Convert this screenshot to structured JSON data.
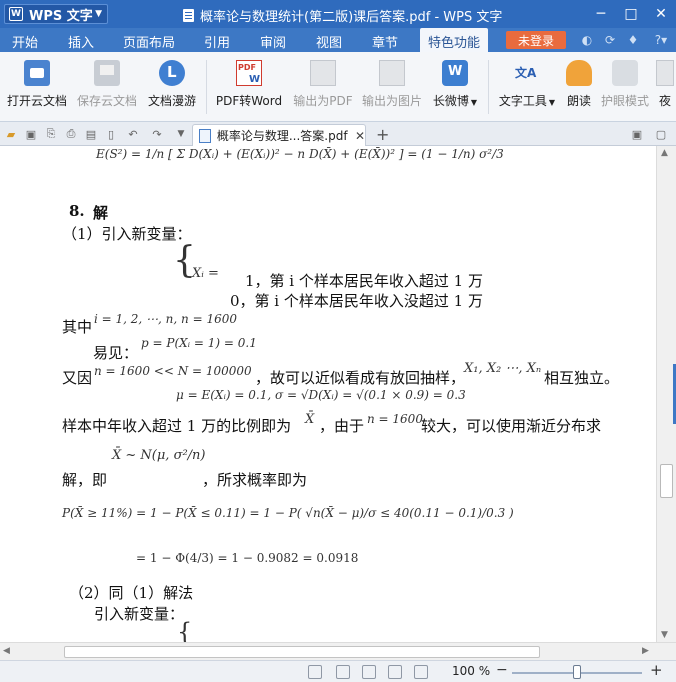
{
  "titlebar": {
    "app_name": "WPS 文字",
    "doc_title": "概率论与数理统计(第二版)课后答案.pdf - WPS 文字",
    "minimize": "─",
    "maximize": "□",
    "close": "✕"
  },
  "menubar": {
    "items": [
      "开始",
      "插入",
      "页面布局",
      "引用",
      "审阅",
      "视图",
      "章节",
      "特色功能"
    ],
    "active": "特色功能",
    "login_label": "未登录",
    "help_label": "?"
  },
  "ribbon": {
    "buttons": [
      {
        "label": "打开云文档",
        "icon": "cloud-open-icon",
        "enabled": true
      },
      {
        "label": "保存云文档",
        "icon": "cloud-save-icon",
        "enabled": false
      },
      {
        "label": "文档漫游",
        "icon": "cloud-roam-icon",
        "enabled": true
      },
      {
        "label": "PDF转Word",
        "icon": "pdf-to-word-icon",
        "enabled": true
      },
      {
        "label": "输出为PDF",
        "icon": "export-pdf-icon",
        "enabled": false
      },
      {
        "label": "输出为图片",
        "icon": "export-image-icon",
        "enabled": false
      },
      {
        "label": "长微博",
        "icon": "weibo-icon",
        "enabled": true
      },
      {
        "label": "文字工具",
        "icon": "text-tool-icon",
        "enabled": true
      },
      {
        "label": "朗读",
        "icon": "read-aloud-icon",
        "enabled": true
      },
      {
        "label": "护眼模式",
        "icon": "eye-protect-icon",
        "enabled": false
      },
      {
        "label": "夜",
        "icon": "night-icon",
        "enabled": true
      }
    ]
  },
  "tabbar": {
    "doc_tab_label": "概率论与数理...答案.pdf",
    "close": "✕",
    "new_tab": "+"
  },
  "document": {
    "top_formula": "E(S²) = 1/n [ Σ D(Xᵢ) + (E(Xᵢ))² − n D(X̄) + (E(X̄))² ] = (1 − 1/n) σ²/3",
    "section_num": "8.",
    "section_word": "解",
    "part1": "（1）引入新变量：",
    "xi_def": "Xᵢ =",
    "case1": "1，第 i 个样本居民年收入超过 1 万",
    "case2": "0，第 i 个样本居民年收入没超过 1 万",
    "where_prefix": "其中",
    "where_formula": "i = 1, 2, ⋯, n, n = 1600",
    "easy_prefix": "易见：",
    "easy_formula": "p = P(Xᵢ = 1) = 0.1",
    "since_prefix": "又因",
    "since_formula": "n = 1600 << N = 100000",
    "since_mid": "，故可以近似看成有放回抽样，",
    "since_vars": "X₁, X₂ ⋯, Xₙ",
    "since_end": "相互独立。",
    "mu_formula": "μ = E(Xᵢ) = 0.1, σ = √D(Xᵢ) = √(0.1 × 0.9) = 0.3",
    "prop_line_a": "样本中年收入超过 1 万的比例即为",
    "prop_xbar": "X̄",
    "prop_line_b": "，由于",
    "prop_n": "n = 1600",
    "prop_line_c": "较大，可以使用渐近分布求",
    "solve_prefix": "解，即",
    "dist_formula": "X̄ ~ N(μ, σ²/n)",
    "solve_suffix": "，所求概率即为",
    "prob_formula": "P(X̄ ≥ 11%) = 1 − P(X̄ ≤ 0.11) = 1 − P( √n(X̄ − μ)/σ ≤ 40(0.11 − 0.1)/0.3 )",
    "result_formula": "= 1 − Φ(4/3) = 1 − 0.9082 = 0.0918",
    "part2": "（2）同（1）解法",
    "part2_sub": "引入新变量："
  },
  "statusbar": {
    "zoom_label": "100 %",
    "zoom_minus": "−",
    "zoom_plus": "+",
    "zoom_level": 0.5
  }
}
